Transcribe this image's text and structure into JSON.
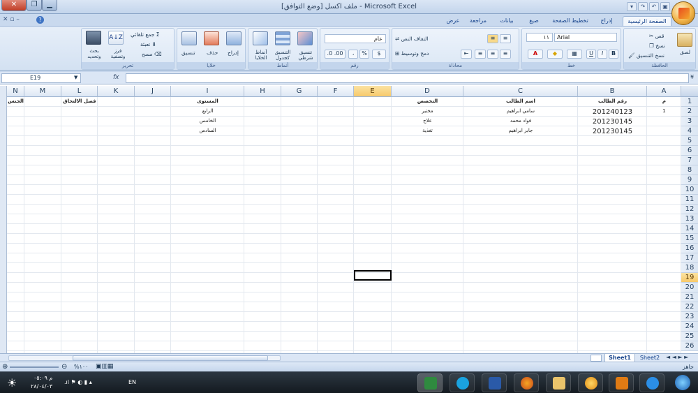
{
  "window": {
    "title": "ملف اكسل  [وضع التوافق] - Microsoft Excel",
    "controls": [
      "_",
      "□",
      "X"
    ]
  },
  "quick_access": [
    "💾",
    "↶",
    "↷",
    "▾"
  ],
  "tabs": [
    {
      "label": "الصفحة الرئيسية",
      "active": true
    },
    {
      "label": "إدراج"
    },
    {
      "label": "تخطيط الصفحة"
    },
    {
      "label": "صيغ"
    },
    {
      "label": "بيانات"
    },
    {
      "label": "مراجعة"
    },
    {
      "label": "عرض"
    }
  ],
  "ribbon": {
    "clipboard": {
      "label": "الحافظة",
      "paste": "لصق",
      "cut": "قص",
      "copy": "نسخ",
      "format_painter": "نسخ التنسيق"
    },
    "font": {
      "label": "خط",
      "name": "Arial",
      "size": "١١"
    },
    "alignment": {
      "label": "محاذاة",
      "wrap": "التفاف النص",
      "merge": "دمج وتوسيط"
    },
    "number": {
      "label": "رقم",
      "format": "عام",
      "percent": "%",
      "comma": "،"
    },
    "styles": {
      "label": "أنماط",
      "conditional": "تنسيق شرطي",
      "table": "التنسيق كجدول",
      "cell_styles": "أنماط الخلايا"
    },
    "cells": {
      "label": "خلايا",
      "insert": "إدراج",
      "delete": "حذف",
      "format": "تنسيق"
    },
    "editing": {
      "label": "تحرير",
      "autosum": "جمع تلقائي",
      "fill": "تعبئة",
      "clear": "مسح",
      "sort": "فرز وتصفية",
      "find": "بحث وتحديد"
    }
  },
  "formula_bar": {
    "name_box": "E19",
    "fx": "fx",
    "value": ""
  },
  "columns": [
    "A",
    "B",
    "C",
    "D",
    "E",
    "F",
    "G",
    "H",
    "I",
    "J",
    "K",
    "L",
    "M",
    "N"
  ],
  "selected_column": "E",
  "selected_row": "19",
  "rows": [
    "1",
    "2",
    "3",
    "4",
    "5",
    "6",
    "7",
    "8",
    "9",
    "10",
    "11",
    "12",
    "13",
    "14",
    "15",
    "16",
    "17",
    "18",
    "19",
    "20",
    "21",
    "22",
    "23",
    "24",
    "25",
    "26"
  ],
  "sheet": {
    "headers": {
      "A": "م",
      "B": "رقم الطالب",
      "C": "اسم الطالب",
      "D": "التخصص",
      "I": "المستوى",
      "L": "فصل الالتحاق",
      "N": "الجنس"
    },
    "data_rows": [
      {
        "A": "1",
        "B": "201240123",
        "C": "سامي ابراهيم",
        "D": "مختبر",
        "I": "الرابع"
      },
      {
        "A": "",
        "B": "201230145",
        "C": "فواد محمد",
        "D": "علاج",
        "I": "الخامس"
      },
      {
        "A": "",
        "B": "201230145",
        "C": "جابر ابراهيم",
        "D": "تغذية",
        "I": "السادس"
      }
    ]
  },
  "sheet_tabs": [
    {
      "label": "Sheet1",
      "active": true
    },
    {
      "label": "Sheet2"
    }
  ],
  "status": {
    "ready": "جاهز",
    "zoom": "%١٠٠"
  },
  "taskbar": {
    "time": "م ٠٥:٠٩",
    "date": "٢٨/٠٤/٠٣",
    "lang": "EN"
  },
  "colors": {
    "selection": "#f7c96a",
    "ribbon": "#dbe7f5",
    "taskbar": "#1b232c"
  }
}
